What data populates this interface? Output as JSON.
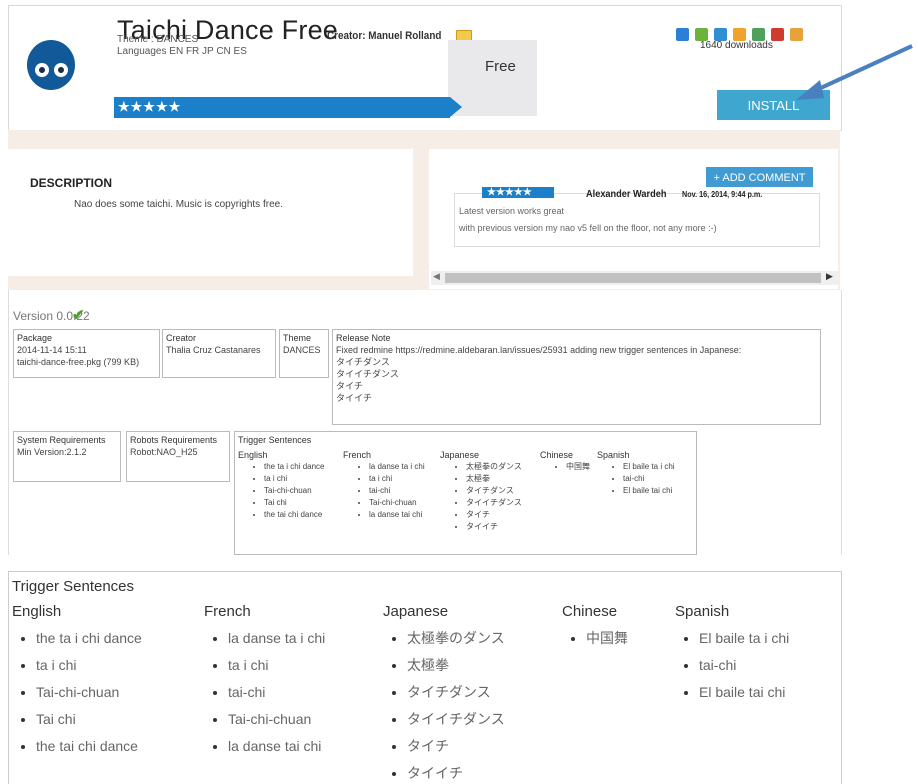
{
  "app": {
    "title": "Taichi Dance Free",
    "creator": "Creator: Manuel Rolland",
    "theme": "Theme : DANCES",
    "languages": "Languages EN FR JP CN ES",
    "rating_stars": "★★★★★",
    "price": "Free",
    "downloads": "1640 downloads",
    "install_label": "INSTALL",
    "badge_colors": [
      "#2b7fd6",
      "#6cb33e",
      "#2f8fd1",
      "#f0a22c",
      "#4ea05a",
      "#d13a2f",
      "#e8a23a"
    ]
  },
  "description": {
    "title": "DESCRIPTION",
    "text": "Nao does some taichi. Music is copyrights free."
  },
  "comments": {
    "add_label": "+ ADD COMMENT",
    "items": [
      {
        "stars": "★★★★★",
        "author": "Alexander Wardeh",
        "date": "Nov. 16, 2014, 9:44 p.m.",
        "line1": "Latest version works great",
        "line2": "with previous version my nao v5 fell on the floor, not any more :-)"
      }
    ]
  },
  "version": {
    "label": "Version 0.0.22",
    "check": "✔",
    "package_head": "Package",
    "package_date": "2014-11-14 15:11",
    "package_file": "taichi-dance-free.pkg (799 KB)",
    "creator_head": "Creator",
    "creator_name": "Thalia Cruz Castanares",
    "theme_head": "Theme",
    "theme_value": "DANCES",
    "release_head": "Release Note",
    "release_lines": [
      "Fixed redmine https://redmine.aldebaran.lan/issues/25931 adding new trigger sentences in Japanese:",
      "タイチダンス",
      "タイイチダンス",
      "タイチ",
      "タイイチ"
    ],
    "sysreq_head": "System Requirements",
    "sysreq_value": "Min Version:2.1.2",
    "robots_head": "Robots Requirements",
    "robots_value": "Robot:NAO_H25"
  },
  "triggers": {
    "title": "Trigger Sentences",
    "columns": [
      {
        "lang": "English",
        "items": [
          "the ta i chi dance",
          "ta i chi",
          "Tai-chi-chuan",
          "Tai chi",
          "the tai chi dance"
        ]
      },
      {
        "lang": "French",
        "items": [
          "la danse ta i chi",
          "ta i chi",
          "tai-chi",
          "Tai-chi-chuan",
          "la danse tai chi"
        ]
      },
      {
        "lang": "Japanese",
        "items": [
          "太極拳のダンス",
          "太極拳",
          "タイチダンス",
          "タイイチダンス",
          "タイチ",
          "タイイチ"
        ]
      },
      {
        "lang": "Chinese",
        "items": [
          "中国舞"
        ]
      },
      {
        "lang": "Spanish",
        "items": [
          "El baile ta i chi",
          "tai-chi",
          "El baile tai chi"
        ]
      }
    ]
  }
}
